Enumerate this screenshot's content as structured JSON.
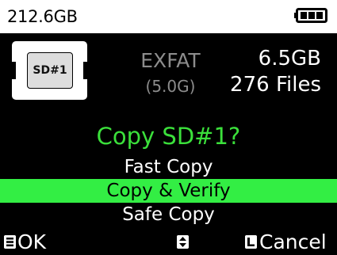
{
  "status": {
    "capacity": "212.6GB",
    "battery_icon": "battery-full-icon"
  },
  "card": {
    "label": "SD#1",
    "icon": "sd-card-icon",
    "filesystem": "EXFAT",
    "filesystem_size": "(5.0G)",
    "used": "6.5GB",
    "files": "276 Files"
  },
  "dialog": {
    "title": "Copy SD#1?",
    "options": [
      "Fast Copy",
      "Copy & Verify",
      "Safe Copy"
    ],
    "selected": "Copy & Verify"
  },
  "softkeys": {
    "ok_label": "OK",
    "ok_icon": "menu-key-icon",
    "nav_icon": "up-down-arrows-icon",
    "cancel_label": "Cancel",
    "cancel_icon": "left-key-icon"
  },
  "colors": {
    "accent_green": "#33ee44",
    "title_green": "#3be03b",
    "muted_gray": "#8c8c8c"
  }
}
